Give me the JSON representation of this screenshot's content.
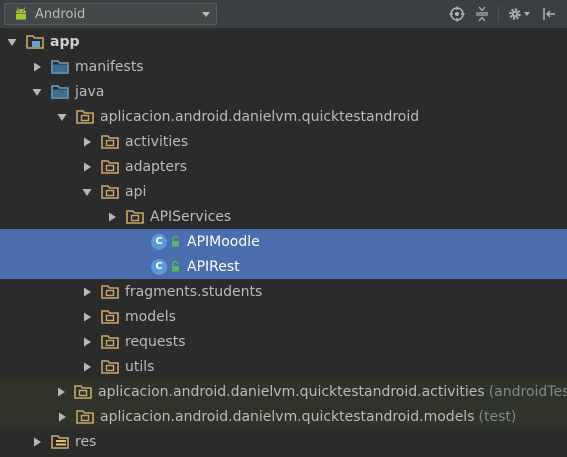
{
  "toolbar": {
    "view_mode": "Android",
    "icons": [
      "android-icon",
      "dropdown-icon",
      "target-icon",
      "collapse-icon",
      "gear-icon",
      "hide-panel-icon"
    ]
  },
  "tree": [
    {
      "label": "app",
      "suffix": "",
      "depth": 0,
      "expanded": true,
      "icon": "module-folder",
      "bold": true,
      "selected": false,
      "test": false
    },
    {
      "label": "manifests",
      "suffix": "",
      "depth": 1,
      "expanded": false,
      "icon": "folder-blue",
      "bold": false,
      "selected": false,
      "test": false
    },
    {
      "label": "java",
      "suffix": "",
      "depth": 1,
      "expanded": true,
      "icon": "folder-blue",
      "bold": false,
      "selected": false,
      "test": false
    },
    {
      "label": "aplicacion.android.danielvm.quicktestandroid",
      "suffix": "",
      "depth": 2,
      "expanded": true,
      "icon": "package",
      "bold": false,
      "selected": false,
      "test": false
    },
    {
      "label": "activities",
      "suffix": "",
      "depth": 3,
      "expanded": false,
      "icon": "package",
      "bold": false,
      "selected": false,
      "test": false
    },
    {
      "label": "adapters",
      "suffix": "",
      "depth": 3,
      "expanded": false,
      "icon": "package",
      "bold": false,
      "selected": false,
      "test": false
    },
    {
      "label": "api",
      "suffix": "",
      "depth": 3,
      "expanded": true,
      "icon": "package",
      "bold": false,
      "selected": false,
      "test": false
    },
    {
      "label": "APIServices",
      "suffix": "",
      "depth": 4,
      "expanded": false,
      "icon": "package",
      "bold": false,
      "selected": false,
      "test": false
    },
    {
      "label": "APIMoodle",
      "suffix": "",
      "depth": 5,
      "expanded": null,
      "icon": "class",
      "bold": false,
      "selected": true,
      "test": false
    },
    {
      "label": "APIRest",
      "suffix": "",
      "depth": 5,
      "expanded": null,
      "icon": "class",
      "bold": false,
      "selected": true,
      "test": false
    },
    {
      "label": "fragments.students",
      "suffix": "",
      "depth": 3,
      "expanded": false,
      "icon": "package",
      "bold": false,
      "selected": false,
      "test": false
    },
    {
      "label": "models",
      "suffix": "",
      "depth": 3,
      "expanded": false,
      "icon": "package",
      "bold": false,
      "selected": false,
      "test": false
    },
    {
      "label": "requests",
      "suffix": "",
      "depth": 3,
      "expanded": false,
      "icon": "package",
      "bold": false,
      "selected": false,
      "test": false
    },
    {
      "label": "utils",
      "suffix": "",
      "depth": 3,
      "expanded": false,
      "icon": "package",
      "bold": false,
      "selected": false,
      "test": false
    },
    {
      "label": "aplicacion.android.danielvm.quicktestandroid.activities",
      "suffix": "(androidTest)",
      "depth": 2,
      "expanded": false,
      "icon": "package",
      "bold": false,
      "selected": false,
      "test": true
    },
    {
      "label": "aplicacion.android.danielvm.quicktestandroid.models",
      "suffix": "(test)",
      "depth": 2,
      "expanded": false,
      "icon": "package",
      "bold": false,
      "selected": false,
      "test": true
    },
    {
      "label": "res",
      "suffix": "",
      "depth": 1,
      "expanded": false,
      "icon": "res-folder",
      "bold": false,
      "selected": false,
      "test": false
    }
  ]
}
